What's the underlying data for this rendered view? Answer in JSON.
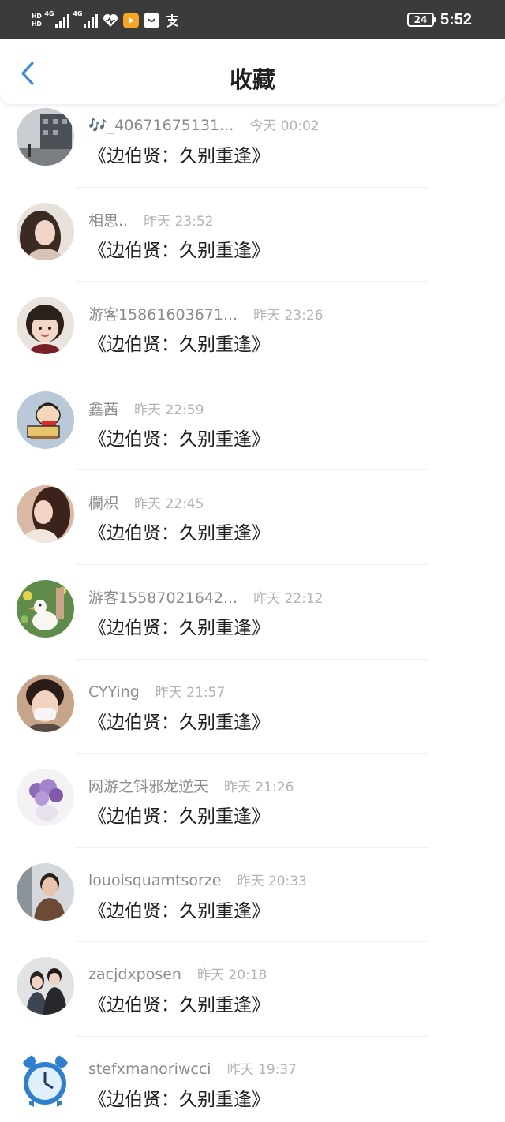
{
  "status_bar": {
    "hd_1": "HD",
    "hd_2": "HD",
    "sim1_label": "4G",
    "sim2_label": "4G",
    "battery": "24",
    "time": "5:52",
    "icons": [
      "heart-rate-icon",
      "orange-video-app-icon",
      "white-bag-app-icon",
      "alipay-icon"
    ]
  },
  "header": {
    "title": "收藏",
    "back_icon": "chevron-left-icon",
    "accent_color": "#3d8ae5"
  },
  "items": [
    {
      "user": "🎶_40671675131...",
      "time": "今天 00:02",
      "book": "《边伯贤：久别重逢》"
    },
    {
      "user": "相思..",
      "time": "昨天 23:52",
      "book": "《边伯贤：久别重逢》"
    },
    {
      "user": "游客15861603671...",
      "time": "昨天 23:26",
      "book": "《边伯贤：久别重逢》"
    },
    {
      "user": "鑫茜",
      "time": "昨天 22:59",
      "book": "《边伯贤：久别重逢》"
    },
    {
      "user": "欄枳",
      "time": "昨天 22:45",
      "book": "《边伯贤：久别重逢》"
    },
    {
      "user": "游客15587021642...",
      "time": "昨天 22:12",
      "book": "《边伯贤：久别重逢》"
    },
    {
      "user": "CYYing",
      "time": "昨天 21:57",
      "book": "《边伯贤：久别重逢》"
    },
    {
      "user": "网游之钭邪龙逆天",
      "time": "昨天 21:26",
      "book": "《边伯贤：久别重逢》"
    },
    {
      "user": "louoisquamtsorze",
      "time": "昨天 20:33",
      "book": "《边伯贤：久别重逢》"
    },
    {
      "user": "zacjdxposen",
      "time": "昨天 20:18",
      "book": "《边伯贤：久别重逢》"
    },
    {
      "user": "stefxmanoriwcci",
      "time": "昨天 19:37",
      "book": "《边伯贤：久别重逢》"
    }
  ]
}
